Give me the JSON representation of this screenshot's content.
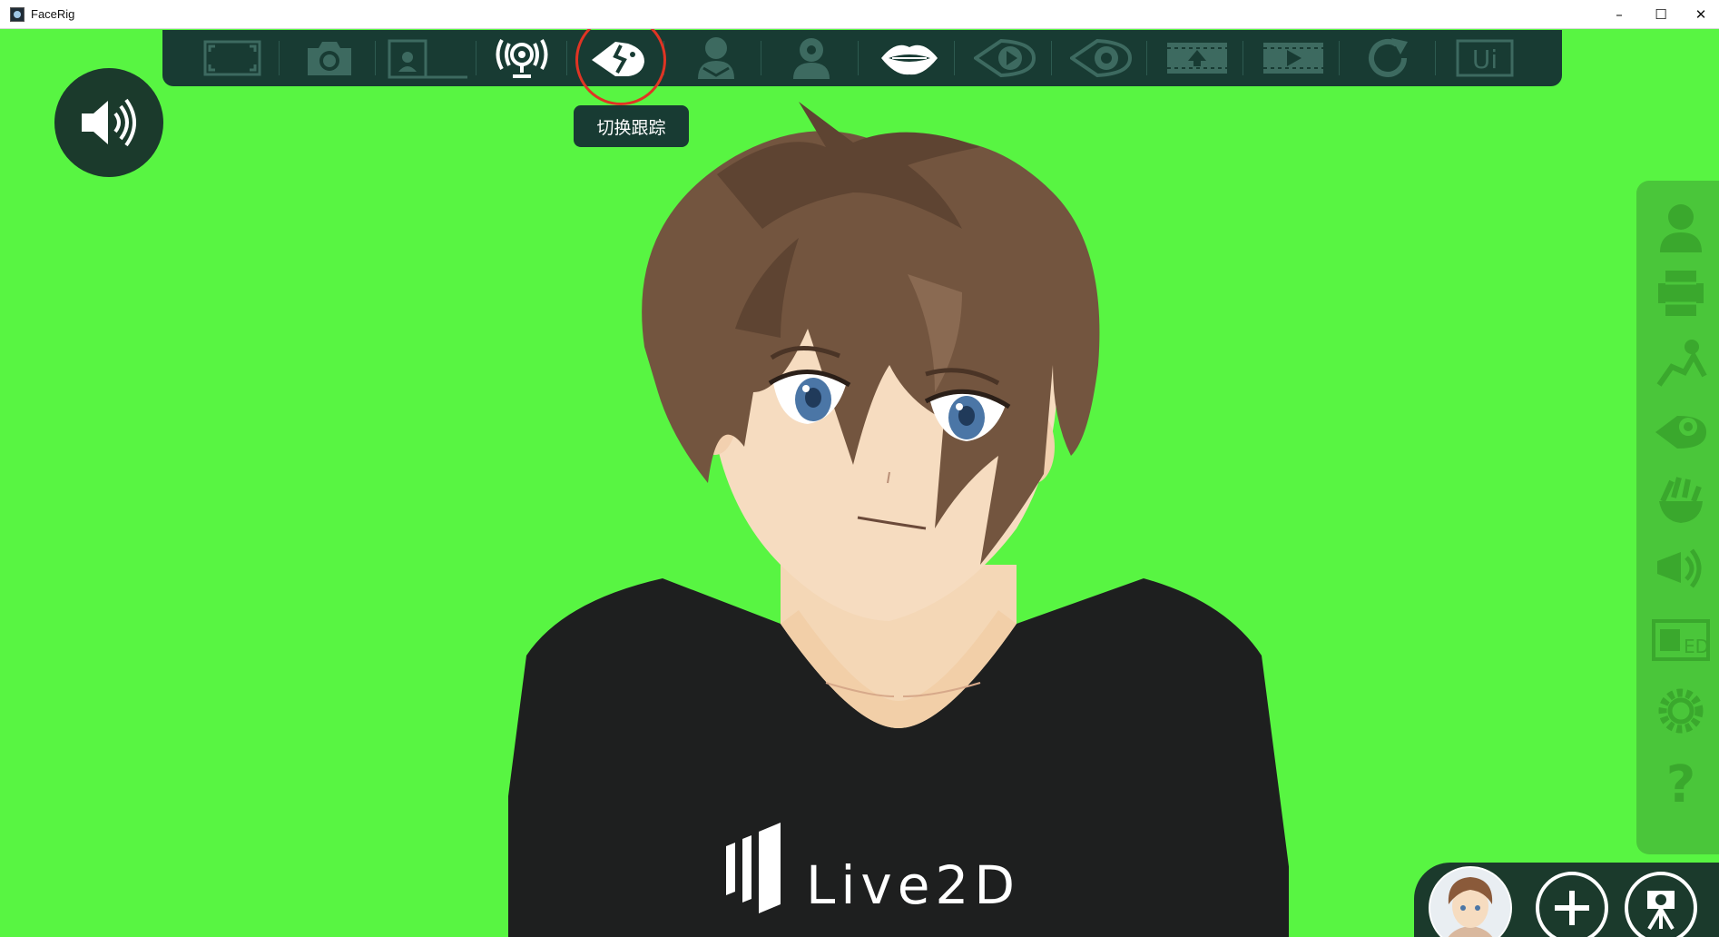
{
  "window": {
    "title": "FaceRig",
    "controls": {
      "minimize": "–",
      "maximize": "☐",
      "close": "✕"
    }
  },
  "colors": {
    "green_screen": "#58f542",
    "toolbar_bg": "#183b33",
    "icon_dim": "#3d6a60",
    "icon_active": "#ffffff",
    "highlight_ring": "#e03424",
    "side_panel": "#4ac63a"
  },
  "toolbar": {
    "items": [
      {
        "name": "fullscreen-icon",
        "state": "disabled"
      },
      {
        "name": "camera-icon",
        "state": "disabled"
      },
      {
        "name": "webcam-pip-icon",
        "state": "disabled"
      },
      {
        "name": "broadcast-webcam-icon",
        "state": "active"
      },
      {
        "name": "toggle-tracking-icon",
        "state": "active",
        "highlighted": true
      },
      {
        "name": "avatar-person-icon",
        "state": "disabled"
      },
      {
        "name": "avatar-settings-icon",
        "state": "disabled"
      },
      {
        "name": "lips-icon",
        "state": "active"
      },
      {
        "name": "play-record-icon",
        "state": "disabled"
      },
      {
        "name": "eye-record-icon",
        "state": "disabled"
      },
      {
        "name": "film-upload-icon",
        "state": "disabled"
      },
      {
        "name": "film-play-icon",
        "state": "disabled"
      },
      {
        "name": "reset-icon",
        "state": "disabled"
      },
      {
        "name": "ui-toggle-icon",
        "state": "disabled",
        "label": "Ui"
      }
    ],
    "tooltip": "切换跟踪"
  },
  "side_panel": {
    "items": [
      "avatar-icon",
      "background-icon",
      "pose-icon",
      "tracking-icon",
      "gesture-icon",
      "broadcast-icon",
      "ed-icon",
      "settings-icon",
      "help-icon"
    ],
    "ed_label": "ED",
    "help_label": "?"
  },
  "dock": {
    "items": [
      "avatar-thumbnail",
      "add-icon",
      "camera-stand-icon"
    ],
    "add_label": "+"
  },
  "shirt_brand": "Live2D"
}
